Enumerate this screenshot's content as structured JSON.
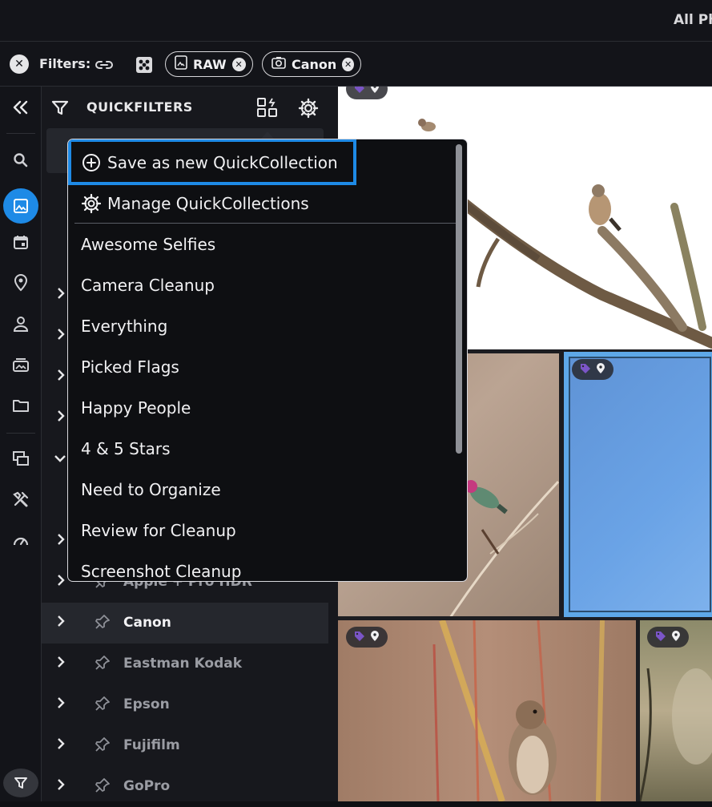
{
  "header": {
    "title": "All Photos"
  },
  "filter_bar": {
    "label": "Filters:",
    "chips": [
      {
        "label": "RAW",
        "icon": "raw-file-icon"
      },
      {
        "label": "Canon",
        "icon": "camera-icon"
      }
    ]
  },
  "rail": {
    "items": [
      "collapse-icon",
      "search-icon",
      "photos-icon",
      "calendar-icon",
      "location-icon",
      "person-icon",
      "albums-icon",
      "folder-icon",
      "duplicates-icon",
      "tools-icon",
      "dashboard-icon",
      "filter-icon"
    ],
    "active": "photos-icon"
  },
  "panel": {
    "title": "QUICKFILTERS",
    "rows": [
      {
        "label": "Apple + Pro HDR",
        "active": false
      },
      {
        "label": "Canon",
        "active": true
      },
      {
        "label": "Eastman Kodak",
        "active": false
      },
      {
        "label": "Epson",
        "active": false
      },
      {
        "label": "Fujifilm",
        "active": false
      },
      {
        "label": "GoPro",
        "active": false
      }
    ]
  },
  "dropdown": {
    "save_label": "Save as new QuickCollection",
    "manage_label": "Manage QuickCollections",
    "collections": [
      "Awesome Selfies",
      "Camera Cleanup",
      "Everything",
      "Picked Flags",
      "Happy People",
      "4 & 5 Stars",
      "Need to Organize",
      "Review for Cleanup",
      "Screenshot Cleanup"
    ]
  },
  "colors": {
    "accent": "#1e8ae6",
    "selected_tile_border": "#5ea8e8",
    "tag_purple": "#7b55c7"
  }
}
